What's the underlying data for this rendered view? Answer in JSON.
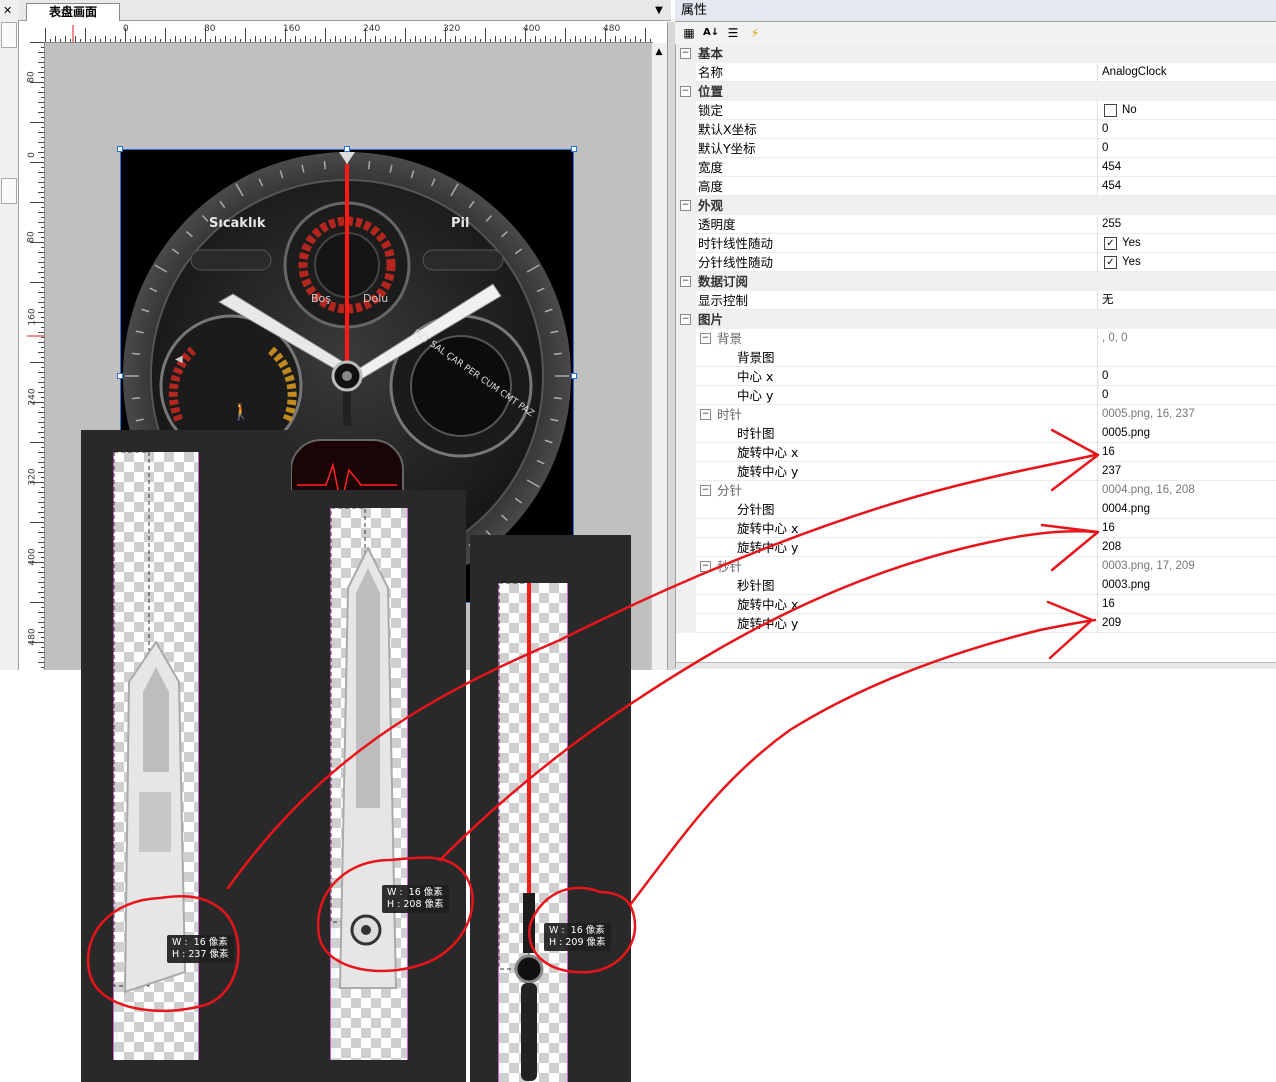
{
  "editor": {
    "tab_label": "表盘画面",
    "ruler_h_labels": [
      "0",
      "80",
      "160",
      "240",
      "320",
      "400",
      "480"
    ],
    "ruler_v_labels": [
      "80",
      "0",
      "80",
      "160",
      "240",
      "320",
      "400",
      "480"
    ]
  },
  "watch": {
    "left_label": "Sıcaklık",
    "right_label": "Pil",
    "gauge_left": "Boş",
    "gauge_right": "Dolu",
    "ring_text": "PZT  SAL  ÇAR  PER  CUM  CMT  PAZ"
  },
  "properties": {
    "title": "属性",
    "rows": [
      {
        "kind": "cat",
        "name": "基本"
      },
      {
        "kind": "field",
        "name": "名称",
        "value": "AnalogClock"
      },
      {
        "kind": "cat",
        "name": "位置"
      },
      {
        "kind": "field",
        "name": "锁定",
        "value": "No",
        "checkbox": false
      },
      {
        "kind": "field",
        "name": "默认X坐标",
        "value": "0"
      },
      {
        "kind": "field",
        "name": "默认Y坐标",
        "value": "0"
      },
      {
        "kind": "field",
        "name": "宽度",
        "value": "454"
      },
      {
        "kind": "field",
        "name": "高度",
        "value": "454"
      },
      {
        "kind": "cat",
        "name": "外观"
      },
      {
        "kind": "field",
        "name": "透明度",
        "value": "255"
      },
      {
        "kind": "field",
        "name": "时针线性随动",
        "value": "Yes",
        "checkbox": true
      },
      {
        "kind": "field",
        "name": "分针线性随动",
        "value": "Yes",
        "checkbox": true
      },
      {
        "kind": "cat",
        "name": "数据订阅"
      },
      {
        "kind": "field",
        "name": "显示控制",
        "value": "无"
      },
      {
        "kind": "cat",
        "name": "图片"
      },
      {
        "kind": "sub",
        "name": "背景",
        "value": ", 0, 0"
      },
      {
        "kind": "leaf",
        "name": "背景图",
        "value": ""
      },
      {
        "kind": "leaf",
        "name": "中心 x",
        "value": "0"
      },
      {
        "kind": "leaf",
        "name": "中心 y",
        "value": "0"
      },
      {
        "kind": "sub",
        "name": "时针",
        "value": "0005.png, 16, 237"
      },
      {
        "kind": "leaf",
        "name": "时针图",
        "value": "0005.png"
      },
      {
        "kind": "leaf",
        "name": "旋转中心 x",
        "value": "16"
      },
      {
        "kind": "leaf",
        "name": "旋转中心 y",
        "value": "237"
      },
      {
        "kind": "sub",
        "name": "分针",
        "value": "0004.png, 16, 208"
      },
      {
        "kind": "leaf",
        "name": "分针图",
        "value": "0004.png"
      },
      {
        "kind": "leaf",
        "name": "旋转中心 x",
        "value": "16"
      },
      {
        "kind": "leaf",
        "name": "旋转中心 y",
        "value": "208"
      },
      {
        "kind": "sub",
        "name": "秒针",
        "value": "0003.png, 17, 209"
      },
      {
        "kind": "leaf",
        "name": "秒针图",
        "value": "0003.png"
      },
      {
        "kind": "leaf",
        "name": "旋转中心 x",
        "value": "16"
      },
      {
        "kind": "leaf",
        "name": "旋转中心 y",
        "value": "209"
      }
    ]
  },
  "hand_panels": {
    "hour": {
      "w_label": "W :  16 像素",
      "h_label": "H : 237 像素"
    },
    "minute": {
      "w_label": "W :  16 像素",
      "h_label": "H : 208 像素"
    },
    "second": {
      "w_label": "W :  16 像素",
      "h_label": "H : 209 像素"
    }
  },
  "colors": {
    "annotation": "#e8141a",
    "selection": "#2a6fd6",
    "second_hand": "#ff1a1a"
  }
}
